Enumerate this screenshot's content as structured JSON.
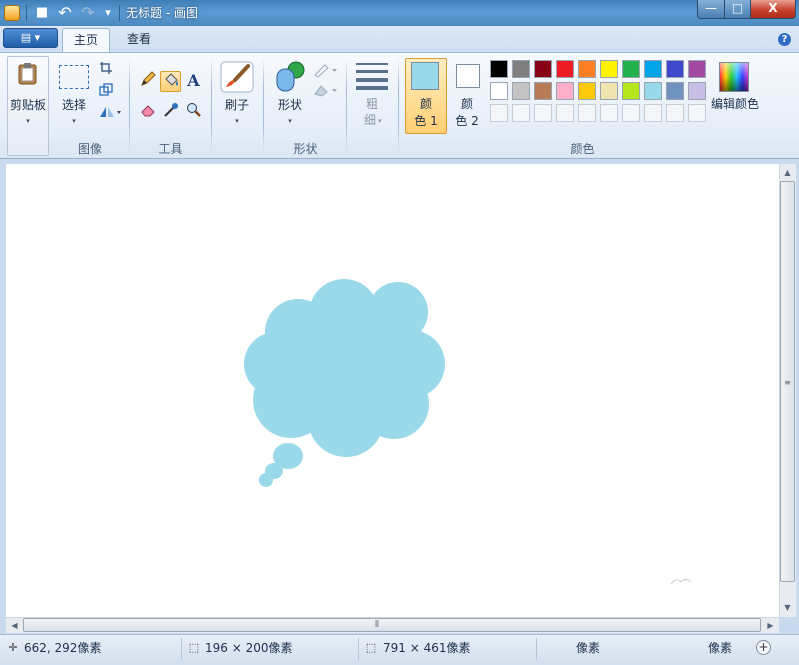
{
  "window": {
    "title": "无标题 - 画图",
    "min_glyph": "—",
    "max_glyph": "□",
    "close_glyph": "X"
  },
  "quick_access": {
    "save_glyph": "■",
    "undo_glyph": "↶",
    "redo_glyph": "↷",
    "customize_glyph": "▾"
  },
  "tabs": {
    "app_menu_glyph": "▤ ▾",
    "home": "主页",
    "view": "查看",
    "help_glyph": "?"
  },
  "ribbon": {
    "clipboard": {
      "label": "剪贴板",
      "arrow": "▾"
    },
    "image": {
      "group_label": "图像",
      "select_label": "选择",
      "arrow": "▾"
    },
    "tools": {
      "group_label": "工具",
      "text_glyph": "A"
    },
    "brush": {
      "label": "刷子",
      "arrow": "▾"
    },
    "shapes": {
      "group_label": "形状",
      "label": "形状",
      "arrow": "▾"
    },
    "size": {
      "label_line1": "粗",
      "label_line2": "细",
      "arrow": "▾"
    },
    "colors": {
      "group_label": "颜色",
      "color1_line1": "颜",
      "color1_line2": "色 1",
      "color2_line1": "颜",
      "color2_line2": "色 2",
      "edit_label": "编辑颜色",
      "color1_value": "#99d9ea",
      "color2_value": "#ffffff",
      "row1": [
        "#000000",
        "#7f7f7f",
        "#880015",
        "#ed1c24",
        "#ff7f27",
        "#fff200",
        "#22b14c",
        "#00a2e8",
        "#3f48cc",
        "#a349a4"
      ],
      "row2": [
        "#ffffff",
        "#c3c3c3",
        "#b97a57",
        "#ffaec9",
        "#ffc90e",
        "#efe4b0",
        "#b5e61d",
        "#99d9ea",
        "#7092be",
        "#c8bfe7"
      ]
    }
  },
  "canvas": {
    "shape_color": "#99d9ea"
  },
  "statusbar": {
    "cursor_pos": "662, 292像素",
    "selection_size": "196 × 200像素",
    "canvas_size": "791 × 461像素",
    "extra1": "像素",
    "extra2": "像素",
    "zoom_plus": "+"
  }
}
